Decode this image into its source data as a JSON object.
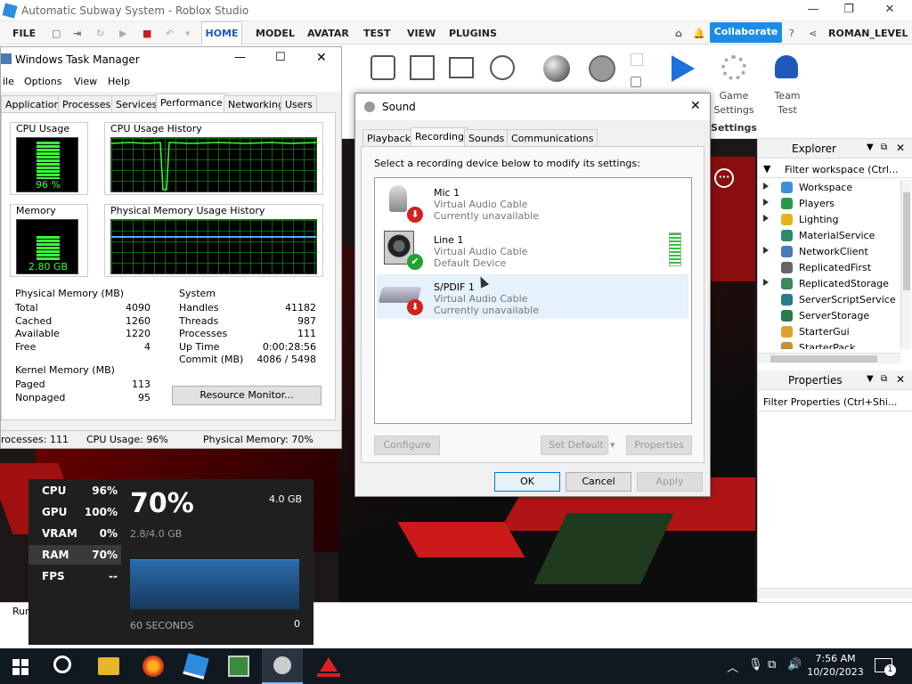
{
  "studio": {
    "title": "Automatic Subway System - Roblox Studio",
    "menu": [
      "FILE",
      "HOME",
      "MODEL",
      "AVATAR",
      "TEST",
      "VIEW",
      "PLUGINS"
    ],
    "collaborate": "Collaborate",
    "user": "ROMAN_LEVEL",
    "ribbon": {
      "game_settings": "Game\nSettings",
      "team_test": "Team\nTest",
      "settings_group": "Settings"
    },
    "explorer": {
      "title": "Explorer",
      "filter": "Filter workspace (Ctrl...",
      "items": [
        {
          "label": "Workspace",
          "expand": true,
          "color": "#3b8fd8"
        },
        {
          "label": "Players",
          "expand": true,
          "color": "#2a9a4a"
        },
        {
          "label": "Lighting",
          "expand": true,
          "color": "#e8b21c"
        },
        {
          "label": "MaterialService",
          "expand": false,
          "color": "#2a8a6a"
        },
        {
          "label": "NetworkClient",
          "expand": true,
          "color": "#4a7ab8"
        },
        {
          "label": "ReplicatedFirst",
          "expand": false,
          "color": "#666666"
        },
        {
          "label": "ReplicatedStorage",
          "expand": true,
          "color": "#3a8a5a"
        },
        {
          "label": "ServerScriptService",
          "expand": false,
          "color": "#2a7a8a"
        },
        {
          "label": "ServerStorage",
          "expand": false,
          "color": "#2a7a4a"
        },
        {
          "label": "StarterGui",
          "expand": false,
          "color": "#e0a030"
        },
        {
          "label": "StarterPack",
          "expand": false,
          "color": "#c89030"
        }
      ]
    },
    "properties": {
      "title": "Properties",
      "filter": "Filter Properties (Ctrl+Shi..."
    },
    "status_left": "Run"
  },
  "taskmgr": {
    "title": "Windows Task Manager",
    "menu": [
      "ile",
      "Options",
      "View",
      "Help"
    ],
    "tabs": [
      "Applications",
      "Processes",
      "Services",
      "Performance",
      "Networking",
      "Users"
    ],
    "active_tab": "Performance",
    "cpu_usage_label": "CPU Usage",
    "cpu_usage_value": "96 %",
    "cpu_history_label": "CPU Usage History",
    "memory_label": "Memory",
    "memory_value": "2.80 GB",
    "mem_history_label": "Physical Memory Usage History",
    "physical_memory": {
      "title": "Physical Memory (MB)",
      "rows": [
        [
          "Total",
          "4090"
        ],
        [
          "Cached",
          "1260"
        ],
        [
          "Available",
          "1220"
        ],
        [
          "Free",
          "4"
        ]
      ]
    },
    "kernel_memory": {
      "title": "Kernel Memory (MB)",
      "rows": [
        [
          "Paged",
          "113"
        ],
        [
          "Nonpaged",
          "95"
        ]
      ]
    },
    "system": {
      "title": "System",
      "rows": [
        [
          "Handles",
          "41182"
        ],
        [
          "Threads",
          "987"
        ],
        [
          "Processes",
          "111"
        ],
        [
          "Up Time",
          "0:00:28:56"
        ],
        [
          "Commit (MB)",
          "4086 / 5498"
        ]
      ]
    },
    "resource_monitor": "Resource Monitor...",
    "status": {
      "processes": "rocesses: 111",
      "cpu": "CPU Usage: 96%",
      "memory": "Physical Memory: 70%"
    }
  },
  "sound": {
    "title": "Sound",
    "tabs": [
      "Playback",
      "Recording",
      "Sounds",
      "Communications"
    ],
    "active_tab": "Recording",
    "instruction": "Select a recording device below to modify its settings:",
    "devices": [
      {
        "name": "Mic 1",
        "driver": "Virtual Audio Cable",
        "status": "Currently unavailable",
        "badge": "down"
      },
      {
        "name": "Line 1",
        "driver": "Virtual Audio Cable",
        "status": "Default Device",
        "badge": "check"
      },
      {
        "name": "S/PDIF 1",
        "driver": "Virtual Audio Cable",
        "status": "Currently unavailable",
        "badge": "down"
      }
    ],
    "buttons": {
      "configure": "Configure",
      "set_default": "Set Default",
      "properties": "Properties",
      "ok": "OK",
      "cancel": "Cancel",
      "apply": "Apply"
    }
  },
  "overlay": {
    "rows": [
      [
        "CPU",
        "96%"
      ],
      [
        "GPU",
        "100%"
      ],
      [
        "VRAM",
        "0%"
      ],
      [
        "RAM",
        "70%"
      ],
      [
        "FPS",
        "--"
      ]
    ],
    "big_value": "70%",
    "max": "4.0 GB",
    "sub": "2.8/4.0 GB",
    "time": "60 SECONDS",
    "zero": "0",
    "ram_fraction": 0.7
  },
  "taskbar": {
    "time": "7:56 AM",
    "date": "10/20/2023",
    "notif": "1"
  }
}
